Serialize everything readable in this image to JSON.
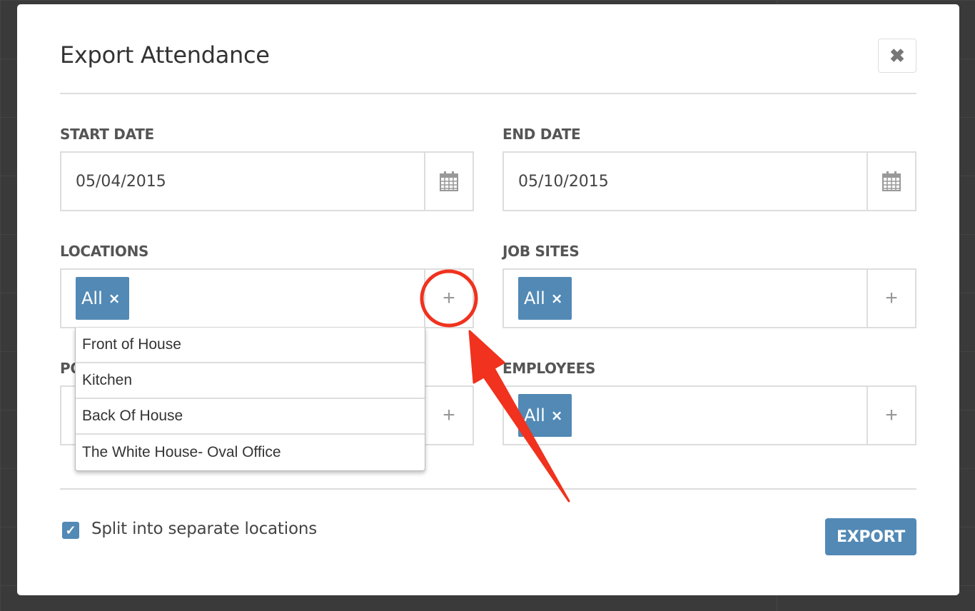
{
  "dialog": {
    "title": "Export Attendance",
    "close_icon": "close-icon"
  },
  "fields": {
    "start_date": {
      "label": "START DATE",
      "value": "05/04/2015",
      "icon": "calendar-icon"
    },
    "end_date": {
      "label": "END DATE",
      "value": "05/10/2015",
      "icon": "calendar-icon"
    },
    "locations": {
      "label": "LOCATIONS",
      "tag": "All",
      "tag_remove": "×",
      "add": "+"
    },
    "job_sites": {
      "label": "JOB SITES",
      "tag": "All",
      "tag_remove": "×",
      "add": "+"
    },
    "positions": {
      "label": "PO",
      "add": "+"
    },
    "employees": {
      "label": "EMPLOYEES",
      "tag": "All",
      "tag_remove": "×",
      "add": "+"
    }
  },
  "locations_dropdown": {
    "options": [
      "Front of House",
      "Kitchen",
      "Back Of House",
      "The White House- Oval Office"
    ]
  },
  "footer": {
    "checkbox_checked": true,
    "checkbox_mark": "✓",
    "checkbox_label": "Split into separate locations",
    "export_label": "EXPORT"
  },
  "colors": {
    "accent": "#5289b5",
    "annotation": "#f0321e"
  }
}
